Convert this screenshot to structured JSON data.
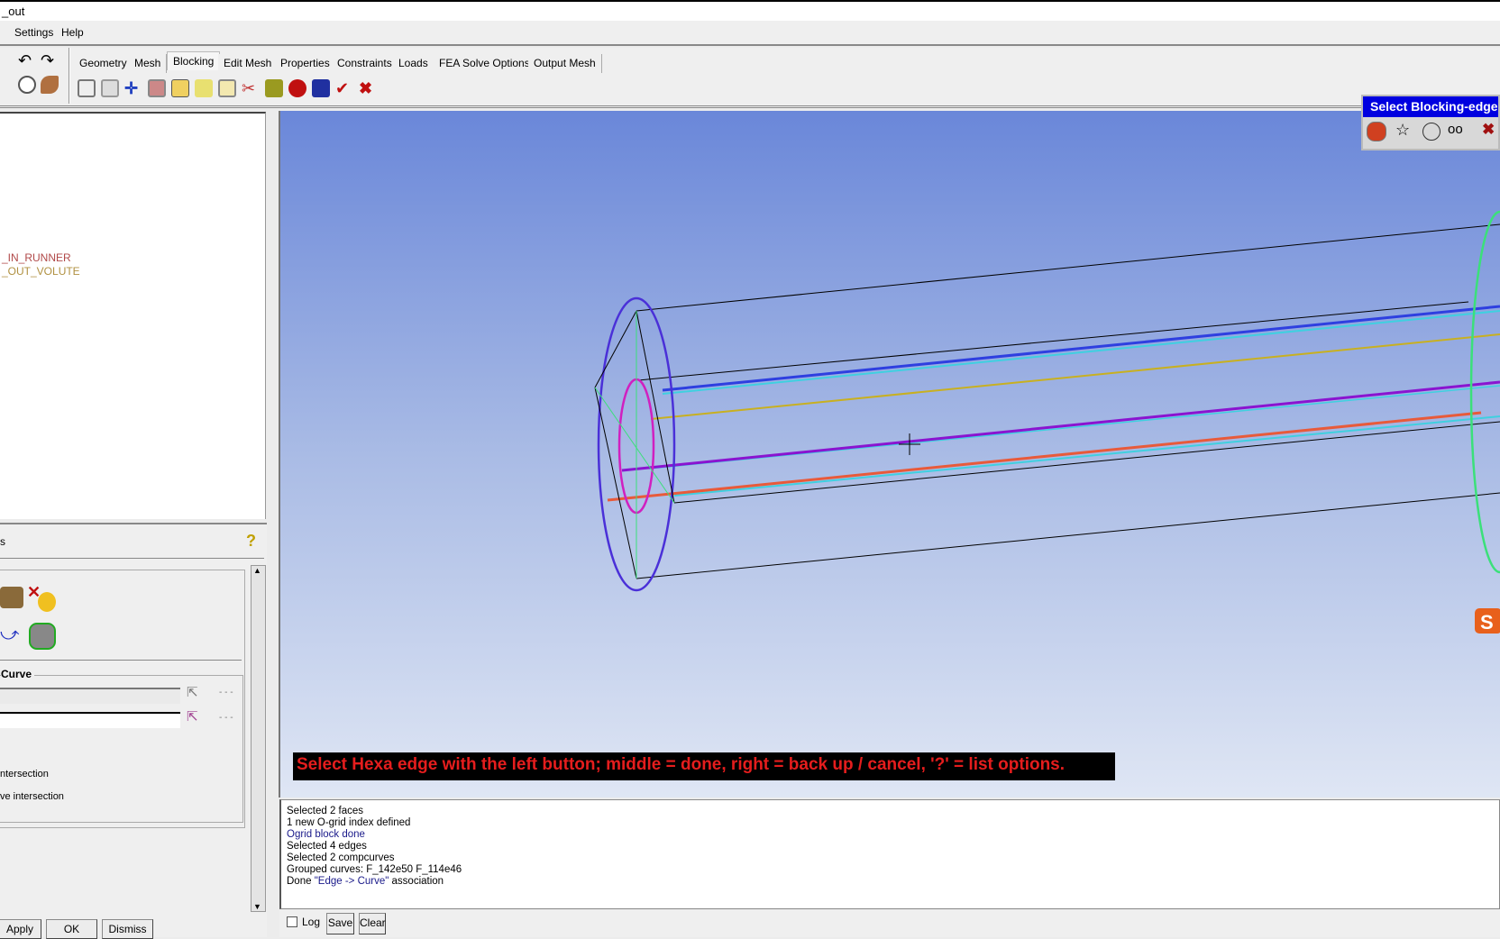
{
  "window": {
    "title": "_out"
  },
  "menu": [
    "Settings",
    "Help"
  ],
  "tabs": [
    "Geometry",
    "Mesh",
    "Blocking",
    "Edit Mesh",
    "Properties",
    "Constraints",
    "Loads",
    "FEA Solve Options",
    "Output Mesh"
  ],
  "active_tab": "Blocking",
  "tree": {
    "items": [
      {
        "label": "_IN_RUNNER",
        "color": "#b04848"
      },
      {
        "label": "_OUT_VOLUTE",
        "color": "#b09040"
      }
    ]
  },
  "panel": {
    "title": "s",
    "section_label": "Curve",
    "option1": "ntersection",
    "option2": "ve intersection",
    "dots1": "- - -",
    "dots2": "- - -",
    "apply": "Apply",
    "ok": "OK",
    "dismiss": "Dismiss"
  },
  "popup": {
    "title": "Select Blocking-edge",
    "icons": [
      "select-icon",
      "star-icon",
      "circle-icon",
      "glasses-icon",
      "cancel-icon"
    ]
  },
  "viewport": {
    "message": "Select Hexa edge with the left button; middle = done, right = back up / cancel, '?' = list options.",
    "edge_colors": [
      "#2e3fe0",
      "#c8b020",
      "#8a14d0",
      "#e85a3a",
      "#3fd0e0",
      "#3be07a",
      "#d020c0"
    ]
  },
  "log": {
    "lines": [
      {
        "text": "Selected 2 faces",
        "c": ""
      },
      {
        "text": "1 new O-grid index defined",
        "c": ""
      },
      {
        "text": "Ogrid block done",
        "c": "blue"
      },
      {
        "text": "Selected 4 edges",
        "c": ""
      },
      {
        "text": "Selected 2 compcurves",
        "c": ""
      },
      {
        "text": "Grouped curves: F_142e50 F_114e46",
        "c": ""
      }
    ],
    "last_prefix": "Done ",
    "last_quote": "\"Edge -> Curve\"",
    "last_suffix": " association",
    "log_label": "Log",
    "save": "Save",
    "clear": "Clear"
  }
}
